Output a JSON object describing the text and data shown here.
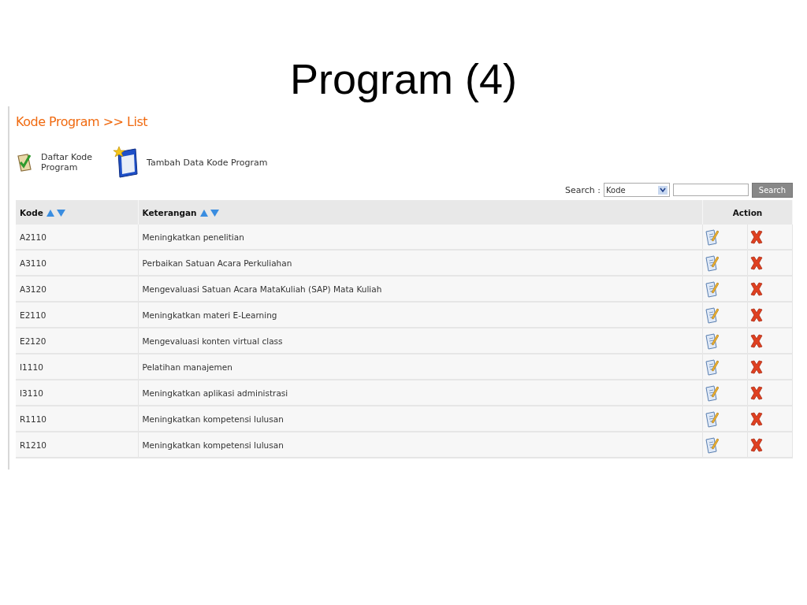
{
  "slide": {
    "title": "Program (4)"
  },
  "page": {
    "heading": "Kode Program >> List",
    "toolbar": [
      {
        "kind": "list",
        "label": "Daftar Kode Program"
      },
      {
        "kind": "add",
        "label": "Tambah Data Kode Program"
      }
    ],
    "search": {
      "label": "Search :",
      "field_value": "Kode",
      "button": "Search"
    },
    "table": {
      "columns": [
        {
          "label": "Kode",
          "sortable": true
        },
        {
          "label": "Keterangan",
          "sortable": true
        },
        {
          "label": "Action",
          "sortable": false
        }
      ],
      "rows": [
        {
          "kode": "A2110",
          "keterangan": "Meningkatkan penelitian"
        },
        {
          "kode": "A3110",
          "keterangan": "Perbaikan Satuan Acara Perkuliahan"
        },
        {
          "kode": "A3120",
          "keterangan": "Mengevaluasi Satuan Acara MataKuliah (SAP) Mata Kuliah"
        },
        {
          "kode": "E2110",
          "keterangan": "Meningkatkan materi E-Learning"
        },
        {
          "kode": "E2120",
          "keterangan": "Mengevaluasi konten virtual class"
        },
        {
          "kode": "I1110",
          "keterangan": "Pelatihan manajemen"
        },
        {
          "kode": "I3110",
          "keterangan": "Meningkatkan aplikasi administrasi"
        },
        {
          "kode": "R1110",
          "keterangan": "Meningkatkan kompetensi lulusan"
        },
        {
          "kode": "R1210",
          "keterangan": "Meningkatkan kompetensi lulusan"
        }
      ]
    }
  }
}
